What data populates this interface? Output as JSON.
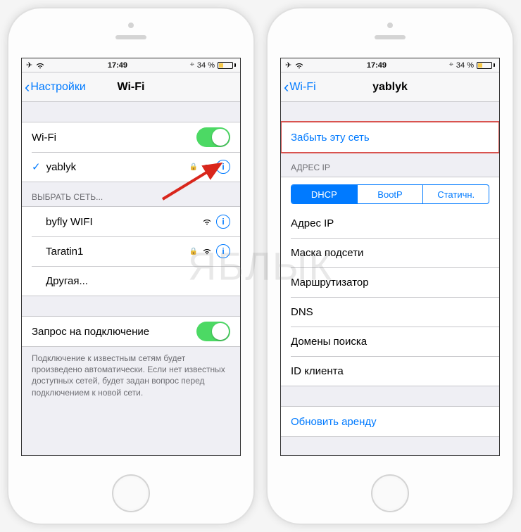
{
  "watermark": "ЯБЛЫК",
  "phone1": {
    "status": {
      "time": "17:49",
      "battery_pct": "34 %"
    },
    "nav": {
      "back": "Настройки",
      "title": "Wi-Fi"
    },
    "wifi_label": "Wi-Fi",
    "connected_network": "yablyk",
    "choose_header": "ВЫБРАТЬ СЕТЬ...",
    "networks": [
      {
        "name": "byfly WIFI",
        "locked": false
      },
      {
        "name": "Taratin1",
        "locked": true
      }
    ],
    "other": "Другая...",
    "ask_join": "Запрос на подключение",
    "ask_join_footer": "Подключение к известным сетям будет произведено автоматически. Если нет известных доступных сетей, будет задан вопрос перед подключением к новой сети."
  },
  "phone2": {
    "status": {
      "time": "17:49",
      "battery_pct": "34 %"
    },
    "nav": {
      "back": "Wi-Fi",
      "title": "yablyk"
    },
    "forget": "Забыть эту сеть",
    "ip_header": "АДРЕС IP",
    "segments": {
      "dhcp": "DHCP",
      "bootp": "BootP",
      "static": "Статичн."
    },
    "rows": {
      "ip": "Адрес IP",
      "mask": "Маска подсети",
      "router": "Маршрутизатор",
      "dns": "DNS",
      "search": "Домены поиска",
      "client": "ID клиента"
    },
    "renew": "Обновить аренду"
  }
}
